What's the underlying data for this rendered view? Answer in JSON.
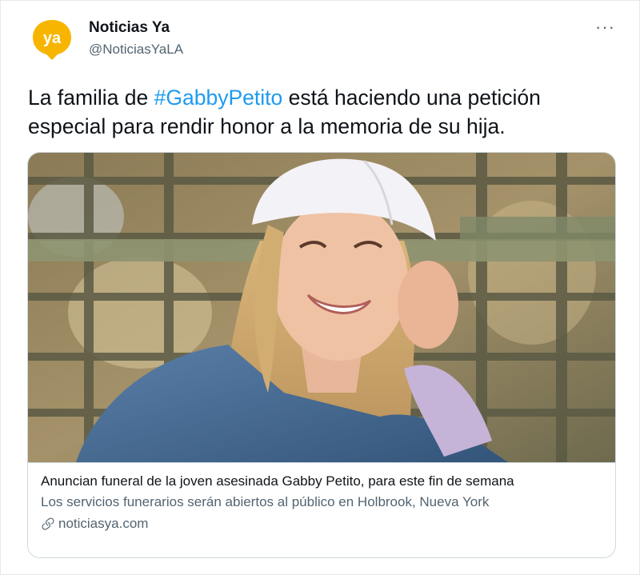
{
  "tweet": {
    "author_name": "Noticias Ya",
    "author_handle": "@NoticiasYaLA",
    "avatar_text": "ya",
    "more_label": "···",
    "text_before": "La familia de ",
    "hashtag": "#GabbyPetito",
    "text_after": " está haciendo una petición especial para rendir honor a la memoria de su hija."
  },
  "card": {
    "title": "Anuncian funeral de la joven asesinada Gabby Petito, para este fin de semana",
    "description": "Los servicios funerarios serán abiertos al público en Holbrook, Nueva York",
    "domain": "noticiasya.com"
  },
  "colors": {
    "brand_yellow": "#f7b500",
    "link_blue": "#1d9bf0",
    "secondary_text": "#536471"
  }
}
